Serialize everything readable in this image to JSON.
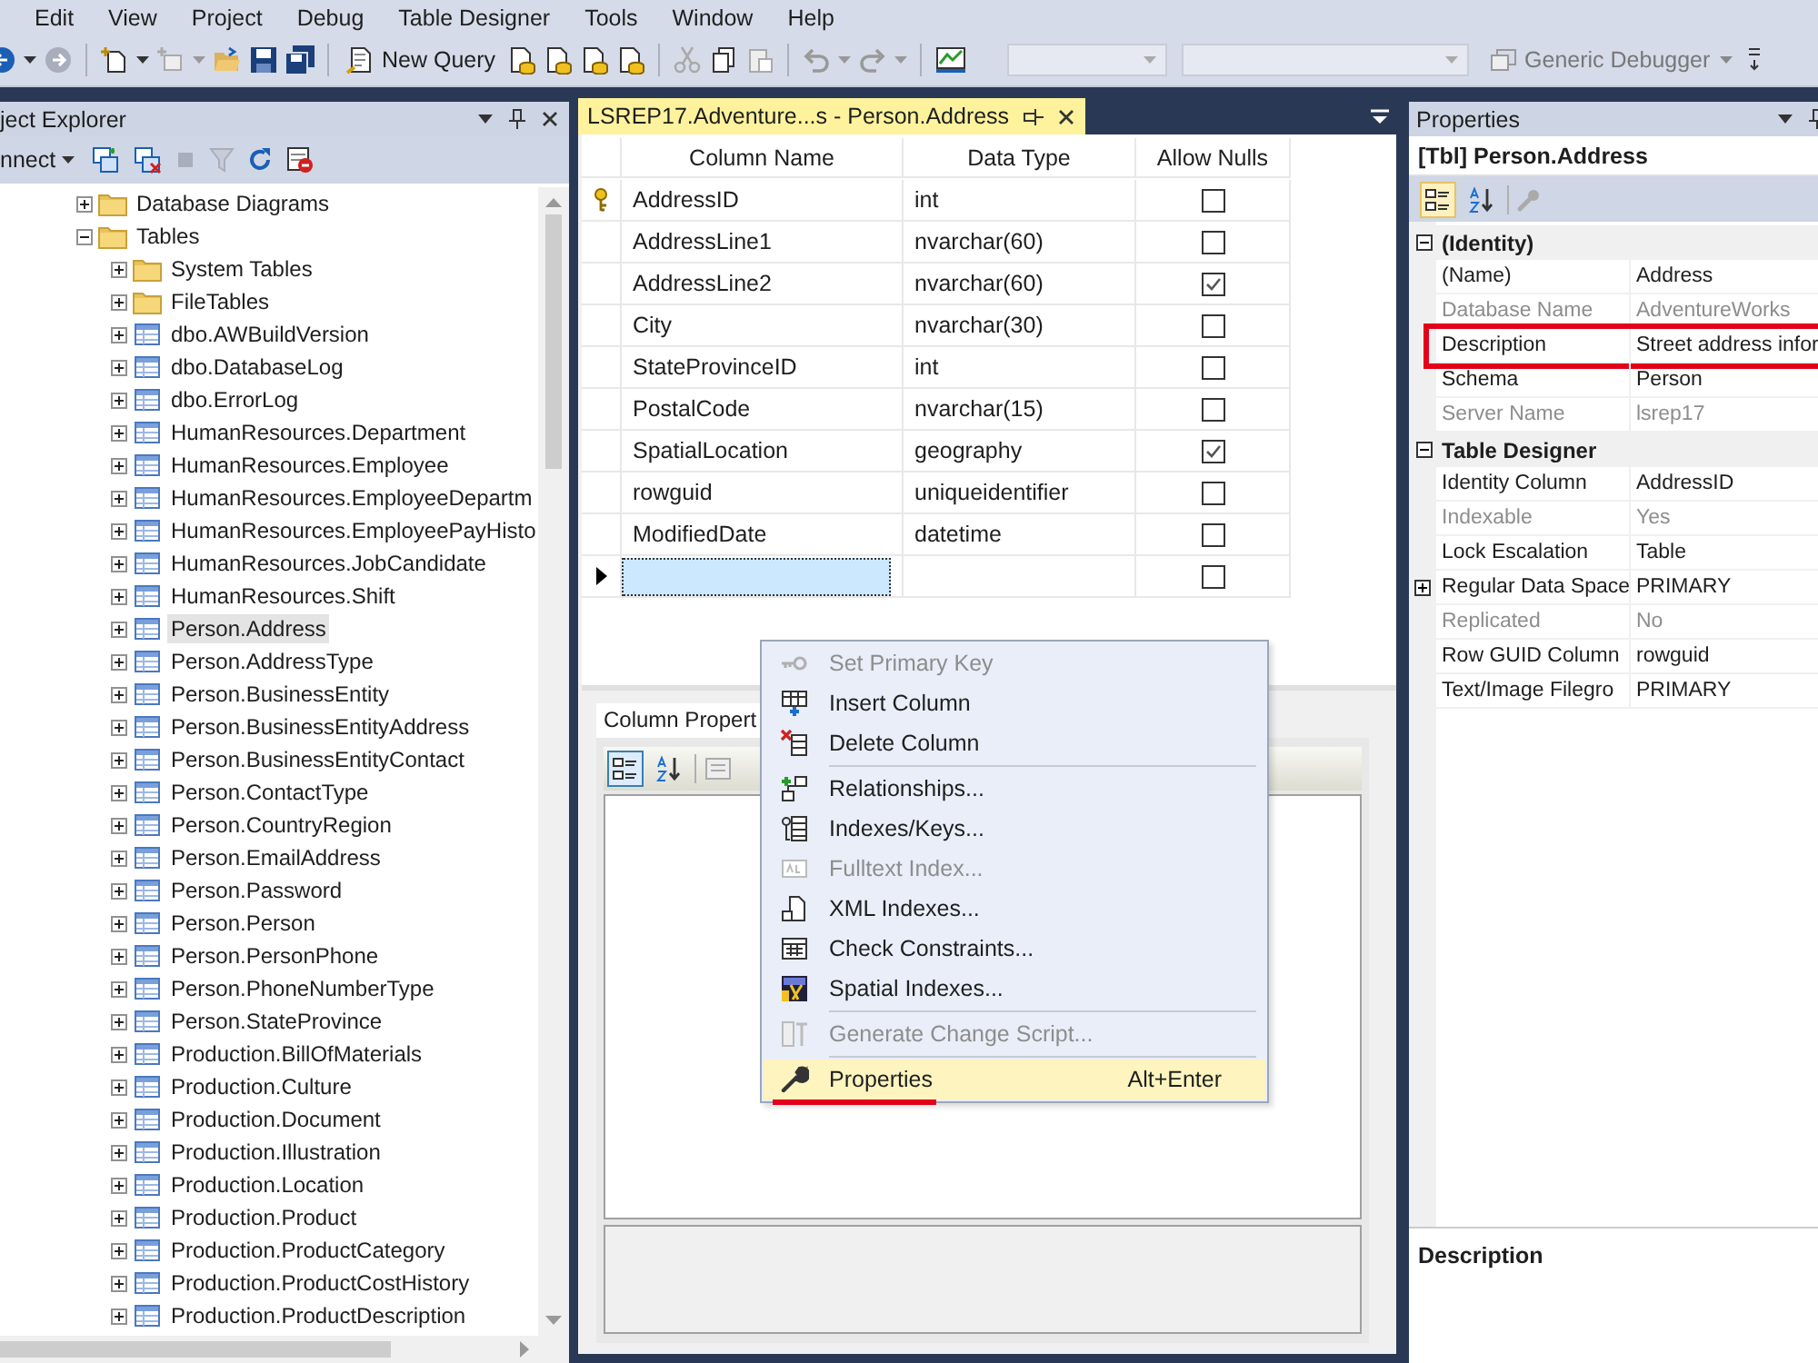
{
  "menu_bar": [
    "Edit",
    "View",
    "Project",
    "Debug",
    "Table Designer",
    "Tools",
    "Window",
    "Help"
  ],
  "toolbar": {
    "new_query": "New Query",
    "debugger": "Generic Debugger"
  },
  "object_explorer": {
    "title": "ject Explorer",
    "connect": "nnect",
    "tree": [
      {
        "label": "Database Diagrams",
        "kind": "folder",
        "expanded": false,
        "selected": false
      },
      {
        "label": "Tables",
        "kind": "folder",
        "expanded": true,
        "selected": false,
        "children": [
          {
            "label": "System Tables",
            "kind": "folder",
            "expanded": false,
            "selected": false
          },
          {
            "label": "FileTables",
            "kind": "folder",
            "expanded": false,
            "selected": false
          },
          {
            "label": "dbo.AWBuildVersion",
            "kind": "table",
            "expanded": false,
            "selected": false
          },
          {
            "label": "dbo.DatabaseLog",
            "kind": "table",
            "expanded": false,
            "selected": false
          },
          {
            "label": "dbo.ErrorLog",
            "kind": "table",
            "expanded": false,
            "selected": false
          },
          {
            "label": "HumanResources.Department",
            "kind": "table",
            "expanded": false,
            "selected": false
          },
          {
            "label": "HumanResources.Employee",
            "kind": "table",
            "expanded": false,
            "selected": false
          },
          {
            "label": "HumanResources.EmployeeDepartm",
            "kind": "table",
            "expanded": false,
            "selected": false
          },
          {
            "label": "HumanResources.EmployeePayHisto",
            "kind": "table",
            "expanded": false,
            "selected": false
          },
          {
            "label": "HumanResources.JobCandidate",
            "kind": "table",
            "expanded": false,
            "selected": false
          },
          {
            "label": "HumanResources.Shift",
            "kind": "table",
            "expanded": false,
            "selected": false
          },
          {
            "label": "Person.Address",
            "kind": "table",
            "expanded": false,
            "selected": true
          },
          {
            "label": "Person.AddressType",
            "kind": "table",
            "expanded": false,
            "selected": false
          },
          {
            "label": "Person.BusinessEntity",
            "kind": "table",
            "expanded": false,
            "selected": false
          },
          {
            "label": "Person.BusinessEntityAddress",
            "kind": "table",
            "expanded": false,
            "selected": false
          },
          {
            "label": "Person.BusinessEntityContact",
            "kind": "table",
            "expanded": false,
            "selected": false
          },
          {
            "label": "Person.ContactType",
            "kind": "table",
            "expanded": false,
            "selected": false
          },
          {
            "label": "Person.CountryRegion",
            "kind": "table",
            "expanded": false,
            "selected": false
          },
          {
            "label": "Person.EmailAddress",
            "kind": "table",
            "expanded": false,
            "selected": false
          },
          {
            "label": "Person.Password",
            "kind": "table",
            "expanded": false,
            "selected": false
          },
          {
            "label": "Person.Person",
            "kind": "table",
            "expanded": false,
            "selected": false
          },
          {
            "label": "Person.PersonPhone",
            "kind": "table",
            "expanded": false,
            "selected": false
          },
          {
            "label": "Person.PhoneNumberType",
            "kind": "table",
            "expanded": false,
            "selected": false
          },
          {
            "label": "Person.StateProvince",
            "kind": "table",
            "expanded": false,
            "selected": false
          },
          {
            "label": "Production.BillOfMaterials",
            "kind": "table",
            "expanded": false,
            "selected": false
          },
          {
            "label": "Production.Culture",
            "kind": "table",
            "expanded": false,
            "selected": false
          },
          {
            "label": "Production.Document",
            "kind": "table",
            "expanded": false,
            "selected": false
          },
          {
            "label": "Production.Illustration",
            "kind": "table",
            "expanded": false,
            "selected": false
          },
          {
            "label": "Production.Location",
            "kind": "table",
            "expanded": false,
            "selected": false
          },
          {
            "label": "Production.Product",
            "kind": "table",
            "expanded": false,
            "selected": false
          },
          {
            "label": "Production.ProductCategory",
            "kind": "table",
            "expanded": false,
            "selected": false
          },
          {
            "label": "Production.ProductCostHistory",
            "kind": "table",
            "expanded": false,
            "selected": false
          },
          {
            "label": "Production.ProductDescription",
            "kind": "table",
            "expanded": false,
            "selected": false
          }
        ]
      }
    ]
  },
  "document_tab": {
    "title": "LSREP17.Adventure...s - Person.Address",
    "selected": true
  },
  "designer": {
    "columns": [
      "Column Name",
      "Data Type",
      "Allow Nulls"
    ],
    "rows": [
      {
        "kind": "column",
        "name": "AddressID",
        "type": "int",
        "allow_nulls": false,
        "primary_key": true,
        "current": false
      },
      {
        "kind": "column",
        "name": "AddressLine1",
        "type": "nvarchar(60)",
        "allow_nulls": false,
        "primary_key": false,
        "current": false
      },
      {
        "kind": "column",
        "name": "AddressLine2",
        "type": "nvarchar(60)",
        "allow_nulls": true,
        "primary_key": false,
        "current": false
      },
      {
        "kind": "column",
        "name": "City",
        "type": "nvarchar(30)",
        "allow_nulls": false,
        "primary_key": false,
        "current": false
      },
      {
        "kind": "column",
        "name": "StateProvinceID",
        "type": "int",
        "allow_nulls": false,
        "primary_key": false,
        "current": false
      },
      {
        "kind": "column",
        "name": "PostalCode",
        "type": "nvarchar(15)",
        "allow_nulls": false,
        "primary_key": false,
        "current": false
      },
      {
        "kind": "column",
        "name": "SpatialLocation",
        "type": "geography",
        "allow_nulls": true,
        "primary_key": false,
        "current": false
      },
      {
        "kind": "column",
        "name": "rowguid",
        "type": "uniqueidentifier",
        "allow_nulls": false,
        "primary_key": false,
        "current": false
      },
      {
        "kind": "column",
        "name": "ModifiedDate",
        "type": "datetime",
        "allow_nulls": false,
        "primary_key": false,
        "current": false
      },
      {
        "kind": "new",
        "allow_nulls": false,
        "primary_key": false,
        "current": true
      }
    ]
  },
  "column_properties": {
    "tab": "Column Propert",
    "sort_buttons": [
      {
        "kind": "categorized",
        "selected": true
      },
      {
        "kind": "alphabetical",
        "selected": false
      }
    ]
  },
  "context_menu": [
    {
      "kind": "item",
      "label": "Set Primary Key",
      "disabled": true,
      "selected": false,
      "marked": false
    },
    {
      "kind": "item",
      "label": "Insert Column",
      "disabled": false,
      "selected": false,
      "marked": false
    },
    {
      "kind": "item",
      "label": "Delete Column",
      "disabled": false,
      "selected": false,
      "marked": false
    },
    {
      "kind": "separator"
    },
    {
      "kind": "item",
      "label": "Relationships...",
      "disabled": false,
      "selected": false,
      "marked": false
    },
    {
      "kind": "item",
      "label": "Indexes/Keys...",
      "disabled": false,
      "selected": false,
      "marked": false
    },
    {
      "kind": "item",
      "label": "Fulltext Index...",
      "disabled": true,
      "selected": false,
      "marked": false
    },
    {
      "kind": "item",
      "label": "XML Indexes...",
      "disabled": false,
      "selected": false,
      "marked": false
    },
    {
      "kind": "item",
      "label": "Check Constraints...",
      "disabled": false,
      "selected": false,
      "marked": false
    },
    {
      "kind": "item",
      "label": "Spatial Indexes...",
      "disabled": false,
      "selected": false,
      "marked": false
    },
    {
      "kind": "separator"
    },
    {
      "kind": "item",
      "label": "Generate Change Script...",
      "disabled": true,
      "selected": false,
      "marked": false
    },
    {
      "kind": "separator"
    },
    {
      "kind": "item",
      "label": "Properties",
      "shortcut": "Alt+Enter",
      "disabled": false,
      "selected": true,
      "marked": true
    }
  ],
  "properties": {
    "title": "Properties",
    "object": "[Tbl] Person.Address",
    "sort_buttons": [
      {
        "kind": "categorized",
        "selected": true
      },
      {
        "kind": "alphabetical",
        "selected": false
      }
    ],
    "categories": [
      {
        "name": "(Identity)",
        "expanded": true,
        "rows": [
          {
            "name": "(Name)",
            "value": "Address",
            "readonly": false,
            "expandable": false,
            "marked": false
          },
          {
            "name": "Database Name",
            "value": "AdventureWorks",
            "readonly": true,
            "expandable": false,
            "marked": false
          },
          {
            "name": "Description",
            "value": "Street address infor",
            "readonly": false,
            "expandable": false,
            "marked": true
          },
          {
            "name": "Schema",
            "value": "Person",
            "readonly": false,
            "expandable": false,
            "marked": false
          },
          {
            "name": "Server Name",
            "value": "lsrep17",
            "readonly": true,
            "expandable": false,
            "marked": false
          }
        ]
      },
      {
        "name": "Table Designer",
        "expanded": true,
        "rows": [
          {
            "name": "Identity Column",
            "value": "AddressID",
            "readonly": false,
            "expandable": false,
            "marked": false
          },
          {
            "name": "Indexable",
            "value": "Yes",
            "readonly": true,
            "expandable": false,
            "marked": false
          },
          {
            "name": "Lock Escalation",
            "value": "Table",
            "readonly": false,
            "expandable": false,
            "marked": false
          },
          {
            "name": "Regular Data Space",
            "value": "PRIMARY",
            "readonly": false,
            "expandable": true,
            "marked": false
          },
          {
            "name": "Replicated",
            "value": "No",
            "readonly": true,
            "expandable": false,
            "marked": false
          },
          {
            "name": "Row GUID Column",
            "value": "rowguid",
            "readonly": false,
            "expandable": false,
            "marked": false
          },
          {
            "name": "Text/Image Filegro",
            "value": "PRIMARY",
            "readonly": false,
            "expandable": false,
            "marked": false
          }
        ]
      }
    ],
    "description_title": "Description"
  }
}
